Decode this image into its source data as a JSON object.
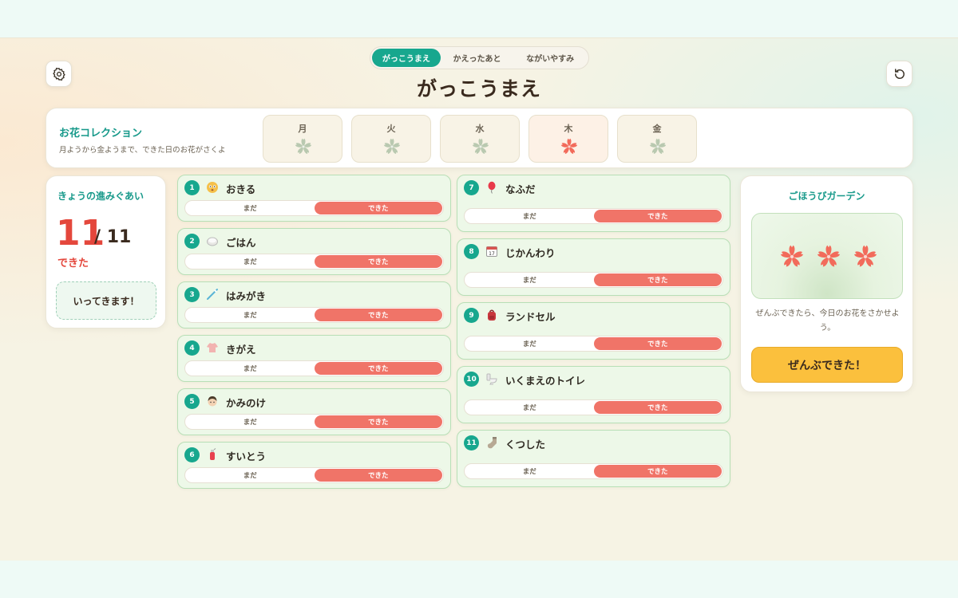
{
  "tabs": [
    {
      "label": "がっこうまえ",
      "active": true
    },
    {
      "label": "かえったあと",
      "active": false
    },
    {
      "label": "ながいやすみ",
      "active": false
    }
  ],
  "title": "がっこうまえ",
  "collection": {
    "title": "お花コレクション",
    "subtitle": "月ようから金ようまで、できた日のお花がさくよ",
    "days": [
      {
        "label": "月",
        "bloomed": false
      },
      {
        "label": "火",
        "bloomed": false
      },
      {
        "label": "水",
        "bloomed": false
      },
      {
        "label": "木",
        "bloomed": true
      },
      {
        "label": "金",
        "bloomed": false
      }
    ]
  },
  "progress": {
    "title": "きょうの進みぐあい",
    "done_count": "11",
    "total": "/ 11",
    "done_label": "できた",
    "leave_button": "いってきます！"
  },
  "toggle": {
    "not_yet": "まだ",
    "done": "できた"
  },
  "tasks": [
    {
      "num": "1",
      "label": "おきる",
      "icon": "face-icon",
      "done": true
    },
    {
      "num": "2",
      "label": "ごはん",
      "icon": "rice-icon",
      "done": true
    },
    {
      "num": "3",
      "label": "はみがき",
      "icon": "toothbrush-icon",
      "done": true
    },
    {
      "num": "4",
      "label": "きがえ",
      "icon": "shirt-icon",
      "done": true
    },
    {
      "num": "5",
      "label": "かみのけ",
      "icon": "hair-icon",
      "done": true
    },
    {
      "num": "6",
      "label": "すいとう",
      "icon": "bottle-icon",
      "done": true
    },
    {
      "num": "7",
      "label": "なふだ",
      "icon": "balloon-icon",
      "done": true
    },
    {
      "num": "8",
      "label": "じかんわり",
      "icon": "calendar-icon",
      "done": true
    },
    {
      "num": "9",
      "label": "ランドセル",
      "icon": "backpack-icon",
      "done": true
    },
    {
      "num": "10",
      "label": "いくまえのトイレ",
      "icon": "toilet-icon",
      "done": true
    },
    {
      "num": "11",
      "label": "くつした",
      "icon": "sock-icon",
      "done": true
    }
  ],
  "garden": {
    "title": "ごほうびガーデン",
    "text": "ぜんぶできたら、今日のお花をさかせよう。",
    "button": "ぜんぶできた！",
    "flowers": 3
  },
  "colors": {
    "accent": "#17a78e",
    "done": "#f07468",
    "flower": "#f26b5b",
    "flower_faded": "#b9c9b0",
    "cta": "#fbc03d"
  }
}
